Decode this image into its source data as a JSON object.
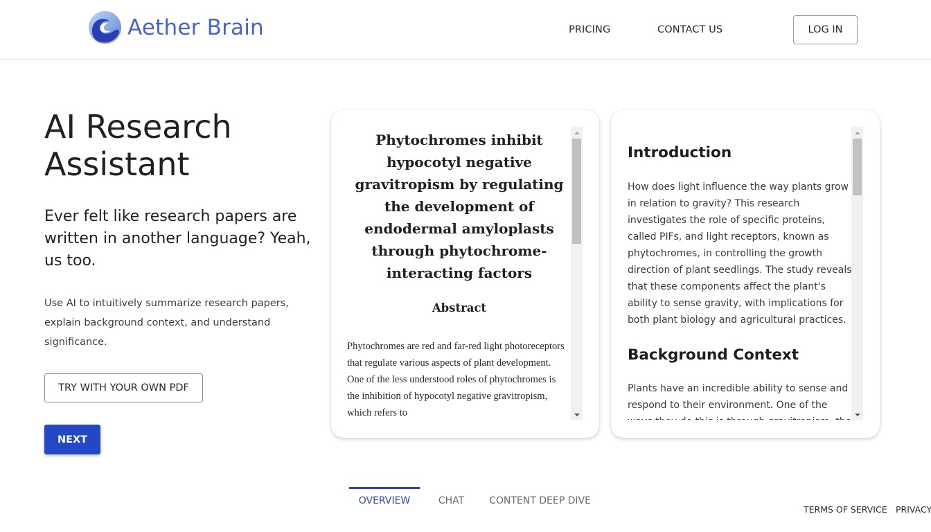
{
  "header": {
    "brand": "Aether Brain",
    "logo_icon": "wave-globe-icon",
    "nav": [
      {
        "label": "PRICING"
      },
      {
        "label": "CONTACT US"
      }
    ],
    "login_label": "LOG IN"
  },
  "hero": {
    "title": "AI Research Assistant",
    "subtitle": "Ever felt like research papers are written in another language? Yeah, us too.",
    "description": "Use AI to intuitively summarize research papers, explain background context, and understand significance.",
    "try_button": "TRY WITH YOUR OWN PDF",
    "next_button": "NEXT"
  },
  "paper_card": {
    "title": "Phytochromes inhibit hypocotyl negative gravitropism by regulating the development of endodermal amyloplasts through phytochrome-interacting factors",
    "abstract_heading": "Abstract",
    "abstract_text": "Phytochromes are red and far-red light photoreceptors that regulate various aspects of plant development. One of the less understood roles of phytochromes is the inhibition of hypocotyl negative gravitropism, which refers to",
    "scroll_position": 0
  },
  "summary_card": {
    "sections": [
      {
        "heading": "Introduction",
        "text": "How does light influence the way plants grow in relation to gravity? This research investigates the role of specific proteins, called PIFs, and light receptors, known as phytochromes, in controlling the growth direction of plant seedlings. The study reveals that these components affect the plant's ability to sense gravity, with implications for both plant biology and agricultural practices."
      },
      {
        "heading": "Background Context",
        "text": "Plants have an incredible ability to sense and respond to their environment. One of the ways they do this is through gravitropism, the"
      }
    ],
    "scroll_position": 0
  },
  "tabs": [
    {
      "label": "OVERVIEW",
      "active": true
    },
    {
      "label": "CHAT",
      "active": false
    },
    {
      "label": "CONTENT DEEP DIVE",
      "active": false
    }
  ],
  "footer": {
    "terms": "TERMS OF SERVICE",
    "privacy": "PRIVACY"
  },
  "colors": {
    "brand": "#4a63c4",
    "primary_button": "#2447c8",
    "active_tab": "#2f4aa6"
  }
}
